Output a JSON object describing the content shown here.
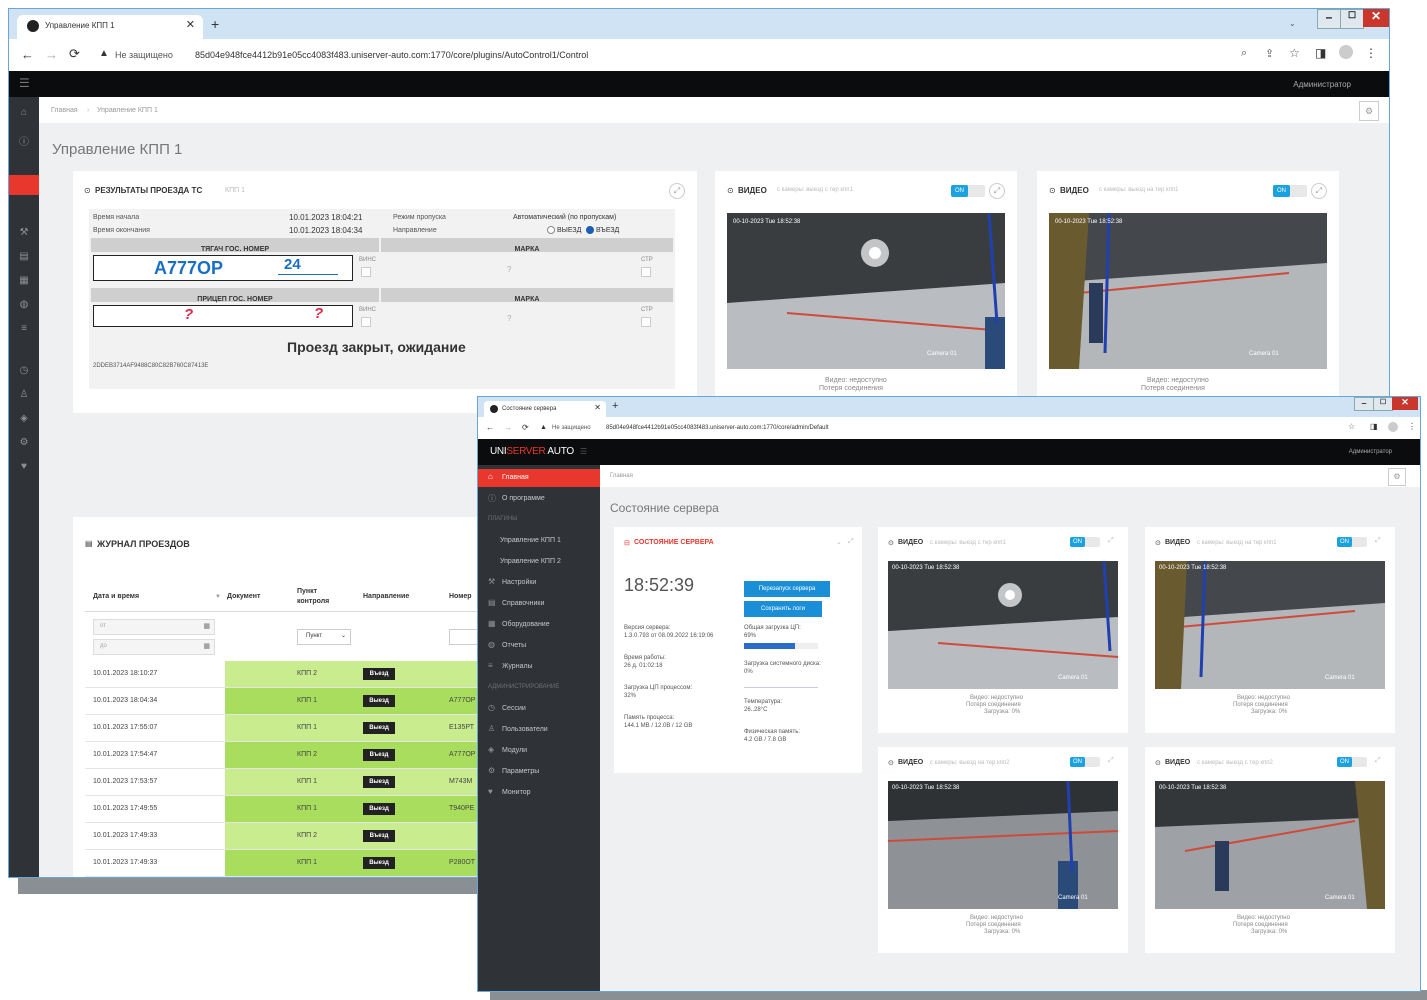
{
  "back_window": {
    "tab_title": "Управление КПП 1",
    "address": "85d04e948fce4412b91e05cc4083f483.uniserver-auto.com:1770/core/plugins/AutoControl1/Control",
    "insecure_label": "Не защищено",
    "user": "Администратор",
    "breadcrumb_home": "Главная",
    "breadcrumb_current": "Управление КПП 1",
    "page_title": "Управление КПП 1",
    "results": {
      "title": "РЕЗУЛЬТАТЫ ПРОЕЗДА ТС",
      "subtitle": "КПП 1",
      "start_label": "Время начала",
      "start_value": "10.01.2023 18:04:21",
      "end_label": "Время окончания",
      "end_value": "10.01.2023 18:04:34",
      "mode_label": "Режим пропуска",
      "mode_value": "Автоматический (по пропускам)",
      "direction_label": "Направление",
      "direction_exit": "ВЫЕЗД",
      "direction_entry": "ВЪЕЗД",
      "tractor_header": "ТЯГАЧ ГОС. НОМЕР",
      "brand_header": "МАРКА",
      "plate_main": "А777ОР",
      "plate_region": "24",
      "wheels_label": "ВИНС",
      "stp_label": "СТР",
      "unknown_mark": "?",
      "trailer_header": "ПРИЦЕП ГОС. НОМЕР",
      "trailer_plate": "?",
      "trailer_region": "?",
      "status": "Проезд закрыт, ожидание",
      "hash": "2DDEB3714AF9488C80C82B760C87413E"
    },
    "video1": {
      "title": "ВИДЕО",
      "subtitle": "с камеры: выезд с тер кпп1",
      "caption1": "Видео: недоступно",
      "caption2": "Потеря соединения"
    },
    "video2": {
      "title": "ВИДЕО",
      "subtitle": "с камеры: выезд на тер кпп1",
      "caption1": "Видео: недоступно",
      "caption2": "Потеря соединения"
    },
    "toggle_on": "ON",
    "journal": {
      "title": "ЖУРНАЛ ПРОЕЗДОВ",
      "col_datetime": "Дата и время",
      "col_document": "Документ",
      "col_point": "Пункт контроля",
      "col_direction": "Направление",
      "col_number": "Номер",
      "filter_from": "от",
      "filter_to": "до",
      "filter_point": "Пункт",
      "rows": [
        {
          "dt": "10.01.2023 18:10:27",
          "point": "КПП 2",
          "dir": "Въезд",
          "num": ""
        },
        {
          "dt": "10.01.2023 18:04:34",
          "point": "КПП 1",
          "dir": "Выезд",
          "num": "А777ОР"
        },
        {
          "dt": "10.01.2023 17:55:07",
          "point": "КПП 1",
          "dir": "Выезд",
          "num": "Е135РТ"
        },
        {
          "dt": "10.01.2023 17:54:47",
          "point": "КПП 2",
          "dir": "Въезд",
          "num": "А777ОР"
        },
        {
          "dt": "10.01.2023 17:53:57",
          "point": "КПП 1",
          "dir": "Выезд",
          "num": "М743М"
        },
        {
          "dt": "10.01.2023 17:49:55",
          "point": "КПП 1",
          "dir": "Выезд",
          "num": "Т940РЕ"
        },
        {
          "dt": "10.01.2023 17:49:33",
          "point": "КПП 2",
          "dir": "Въезд",
          "num": ""
        },
        {
          "dt": "10.01.2023 17:49:33",
          "point": "КПП 1",
          "dir": "Выезд",
          "num": "Р280ОТ"
        }
      ]
    }
  },
  "front_window": {
    "tab_title": "Состояние сервера",
    "address": "85d04e948fce4412b91e05cc4083f483.uniserver-auto.com:1770/core/admin/Default",
    "insecure_label": "Не защищено",
    "logo_a": "UNI",
    "logo_b": "SERVER",
    "logo_c": " AUTO",
    "user": "Администратор",
    "sidebar": {
      "items": [
        {
          "label": "Главная",
          "icon": "home-icon",
          "active": true
        },
        {
          "label": "О программе",
          "icon": "info-icon"
        },
        {
          "label": "ПЛАГИНЫ",
          "section": true
        },
        {
          "label": "Управление КПП 1",
          "sub": true
        },
        {
          "label": "Управление КПП 2",
          "sub": true
        },
        {
          "label": "Настройки",
          "icon": "wrench-icon"
        },
        {
          "label": "Справочники",
          "icon": "book-icon"
        },
        {
          "label": "Оборудование",
          "icon": "grid-icon"
        },
        {
          "label": "Отчеты",
          "icon": "globe-icon"
        },
        {
          "label": "Журналы",
          "icon": "list-icon"
        },
        {
          "label": "АДМИНИСТРИРОВАНИЕ",
          "section": true
        },
        {
          "label": "Сессии",
          "icon": "clock-icon"
        },
        {
          "label": "Пользователи",
          "icon": "users-icon"
        },
        {
          "label": "Модули",
          "icon": "box-icon"
        },
        {
          "label": "Параметры",
          "icon": "gear-icon"
        },
        {
          "label": "Монитор",
          "icon": "heart-icon"
        }
      ]
    },
    "breadcrumb_home": "Главная",
    "page_title": "Состояние сервера",
    "server": {
      "title": "СОСТОЯНИЕ СЕРВЕРА",
      "time": "18:52:39",
      "restart_button": "Перезапуск сервера",
      "save_logs_button": "Сохранить логи",
      "version_label": "Версия сервера:",
      "version_value": "1.3.0.793 от 08.09.2022 16:19:06",
      "uptime_label": "Время работы:",
      "uptime_value": "26 д. 01:02:18",
      "proc_cpu_label": "Загрузка ЦП процессом:",
      "proc_cpu_value": "32%",
      "proc_mem_label": "Память процесса:",
      "proc_mem_value": "144.1 MB / 12.0B / 12 GB",
      "cpu_label": "Общая загрузка ЦП:",
      "cpu_value": "69%",
      "cpu_load": 0.69,
      "disk_label": "Загрузка системного диска:",
      "disk_value": "0%",
      "temp_label": "Температура:",
      "temp_value": "26..28°С",
      "phys_mem_label": "Физическая память:",
      "phys_mem_value": "4.2 GB / 7.8 GB"
    },
    "videos": [
      {
        "title": "ВИДЕО",
        "subtitle": "с камеры: выезд с тер кпп1",
        "caption1": "Видео: недоступно",
        "caption2": "Потеря соединения",
        "caption3": "Загрузка: 0%"
      },
      {
        "title": "ВИДЕО",
        "subtitle": "с камеры: выезд на тер кпп1",
        "caption1": "Видео: недоступно",
        "caption2": "Потеря соединения",
        "caption3": "Загрузка: 0%"
      },
      {
        "title": "ВИДЕО",
        "subtitle": "с камеры: выезд на тер кпп2",
        "caption1": "Видео: недоступно",
        "caption2": "Потеря соединения",
        "caption3": "Загрузка: 0%"
      },
      {
        "title": "ВИДЕО",
        "subtitle": "с камеры: выезд с тер кпп2",
        "caption1": "Видео: недоступно",
        "caption2": "Потеря соединения",
        "caption3": "Загрузка: 0%"
      }
    ],
    "toggle_on": "ON",
    "cam_timestamp": "00-10-2023 Tue 18:52:38",
    "cam_label": "Camera 01"
  }
}
